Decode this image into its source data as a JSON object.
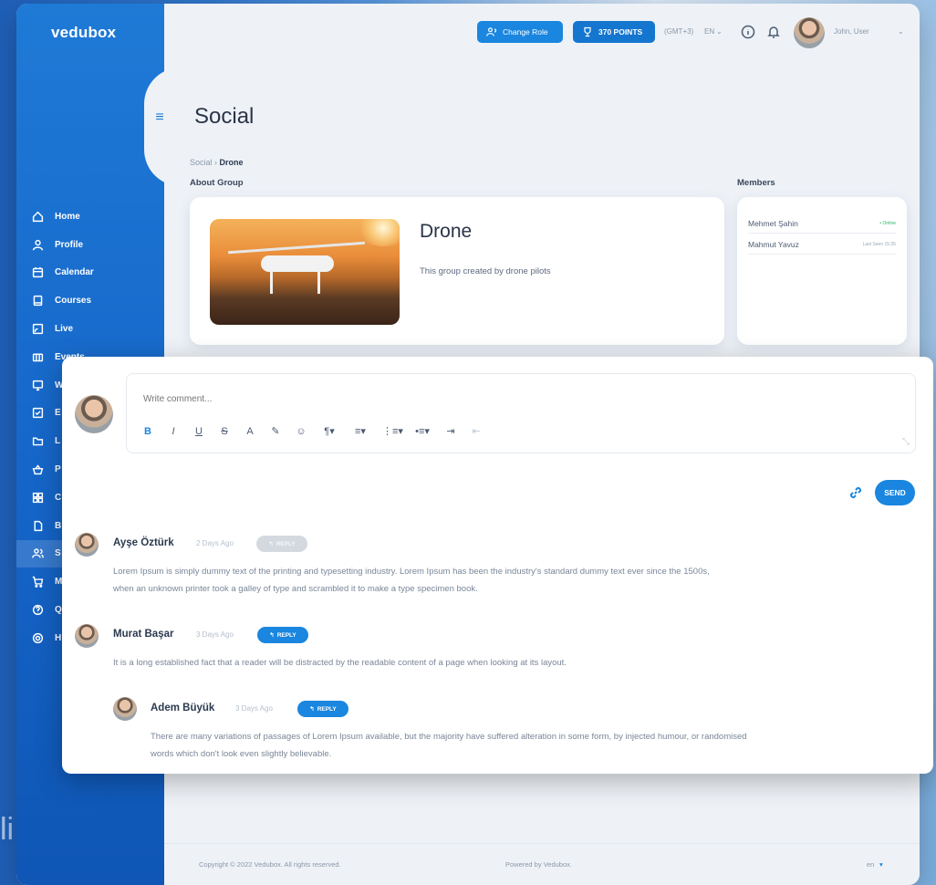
{
  "app": {
    "logo": "vedubox"
  },
  "header": {
    "change_role_label": "Change Role",
    "points_label": "370 POINTS",
    "timezone": "(GMT+3)",
    "language": "EN",
    "user_name": "John, User"
  },
  "sidebar": {
    "items": [
      {
        "label": "Home",
        "icon": "home-icon"
      },
      {
        "label": "Profile",
        "icon": "user-icon"
      },
      {
        "label": "Calendar",
        "icon": "calendar-icon"
      },
      {
        "label": "Courses",
        "icon": "book-icon"
      },
      {
        "label": "Live",
        "icon": "cast-icon"
      },
      {
        "label": "Events",
        "icon": "ticket-icon"
      },
      {
        "label": "W",
        "icon": "monitor-icon"
      },
      {
        "label": "E",
        "icon": "checklist-icon"
      },
      {
        "label": "L",
        "icon": "folder-icon"
      },
      {
        "label": "P",
        "icon": "basket-icon"
      },
      {
        "label": "C",
        "icon": "grid-icon"
      },
      {
        "label": "B",
        "icon": "file-icon"
      },
      {
        "label": "S",
        "icon": "users-icon"
      },
      {
        "label": "M",
        "icon": "cart-icon"
      },
      {
        "label": "Q",
        "icon": "help-icon"
      },
      {
        "label": "H",
        "icon": "lifebuoy-icon"
      }
    ],
    "active_index": 12
  },
  "page": {
    "title": "Social",
    "breadcrumb": {
      "parent": "Social",
      "separator": "›",
      "current": "Drone"
    },
    "about_label": "About Group",
    "members_label": "Members"
  },
  "group": {
    "name": "Drone",
    "description": "This group created by drone pilots"
  },
  "members": [
    {
      "name": "Mehmet Şahin",
      "status": "• Online",
      "online": true
    },
    {
      "name": "Mahmut Yavuz",
      "status": "Last Seen 15:35",
      "online": false
    }
  ],
  "composer": {
    "placeholder": "Write comment...",
    "send_label": "SEND",
    "toolbar": [
      "B",
      "I",
      "U",
      "S",
      "A",
      "✎",
      "☺",
      "¶▾",
      "≡▾",
      "⋮≡▾",
      "•≡▾",
      "⇥",
      "⇤"
    ]
  },
  "comments": [
    {
      "author": "Ayşe Öztürk",
      "time": "2 Days Ago",
      "reply_label": "REPLY",
      "text_line1": "Lorem Ipsum is simply dummy text of the printing and typesetting industry. Lorem Ipsum has been the industry's standard dummy text ever since the 1500s,",
      "text_line2": "when an unknown printer took a galley of type and scrambled it to make a type specimen book."
    },
    {
      "author": "Murat Başar",
      "time": "3 Days Ago",
      "reply_label": "REPLY",
      "text_line1": "It is a long established fact that a reader will be distracted by the readable content of a page when looking at its layout."
    },
    {
      "author": "Adem Büyük",
      "time": "3 Days Ago",
      "reply_label": "REPLY",
      "text_line1": "There are many variations of passages of Lorem Ipsum available, but the majority have suffered alteration in some form, by injected humour, or randomised",
      "text_line2": "words which don't look even slightly believable."
    }
  ],
  "footer": {
    "copyright": "Copyright © 2022 Vedubox. All rights reserved.",
    "powered": "Powered by Vedubox.",
    "lang": "en"
  },
  "background": {
    "partial_text": "li"
  },
  "colors": {
    "primary": "#1a86df",
    "sidebar": "#1565c8",
    "online": "#2ab66a"
  }
}
